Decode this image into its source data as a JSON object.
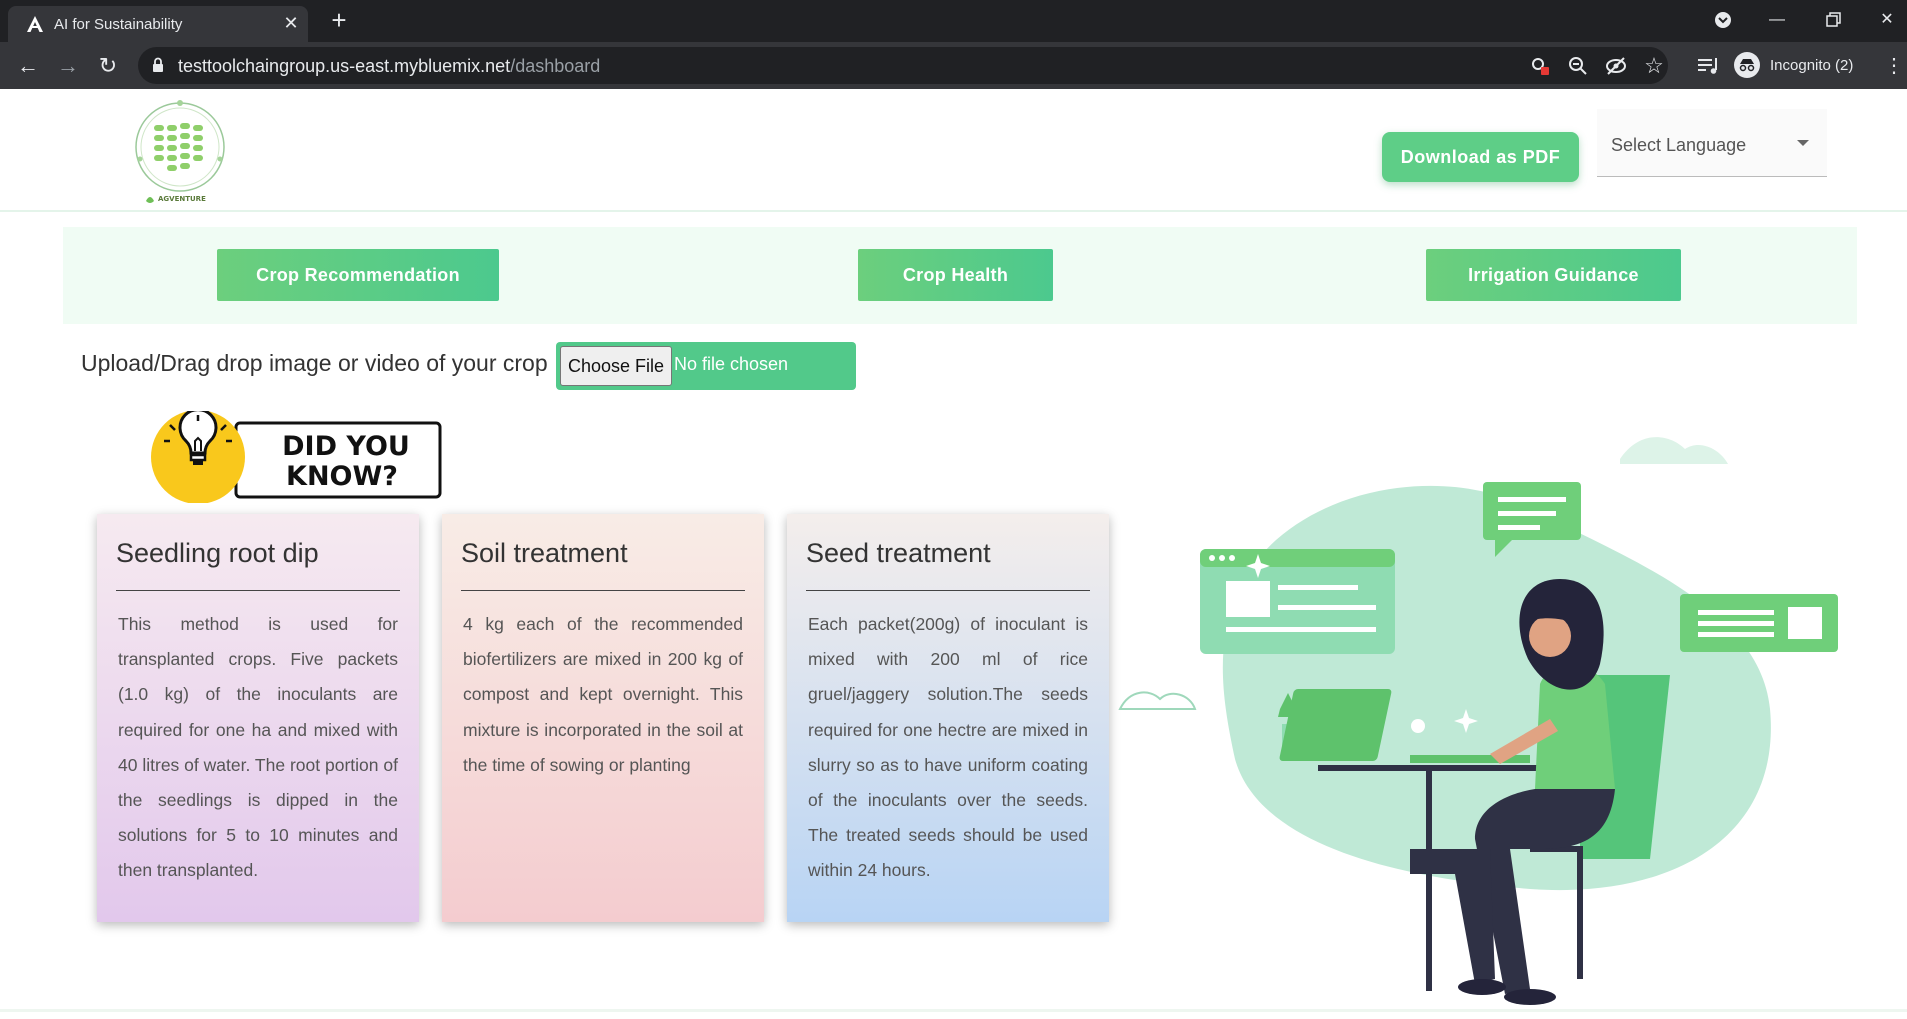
{
  "browser": {
    "tab_title": "AI for Sustainability",
    "url_host": "testtoolchaingroup.us-east.mybluemix.net",
    "url_path": "/dashboard",
    "incognito_label": "Incognito (2)"
  },
  "header": {
    "logo_text": "AGVENTURE",
    "download_pdf_label": "Download as PDF",
    "language_select_label": "Select Language"
  },
  "nav": {
    "crop_recommendation": "Crop Recommendation",
    "crop_health": "Crop Health",
    "irrigation_guidance": "Irrigation Guidance"
  },
  "upload": {
    "label": "Upload/Drag drop image or video of your crop",
    "choose_file": "Choose File",
    "no_file": "No file chosen"
  },
  "did_you_know": {
    "line1": "DID YOU",
    "line2": "KNOW?"
  },
  "cards": [
    {
      "title": "Seedling root dip",
      "text": "This method is used for transplanted crops. Five packets (1.0 kg) of the inoculants are required for one ha and mixed with 40 litres of water. The root portion of the seedlings is dipped in the solutions for 5 to 10 minutes and then transplanted."
    },
    {
      "title": "Soil treatment",
      "text": "4 kg each of the recommended biofertilizers are mixed in 200 kg of compost and kept overnight. This mixture is incorporated in the soil at the time of sowing or planting"
    },
    {
      "title": "Seed treatment",
      "text": "Each packet(200g) of inoculant is mixed with 200 ml of rice gruel/jaggery solution.The seeds required for one hectre are mixed in slurry so as to have uniform coating of the inoculants over the seeds. The treated seeds should be used within 24 hours."
    }
  ],
  "colors": {
    "accent_green": "#5ece87",
    "nav_bg": "#f0fcf4",
    "chrome_dark": "#202124"
  }
}
